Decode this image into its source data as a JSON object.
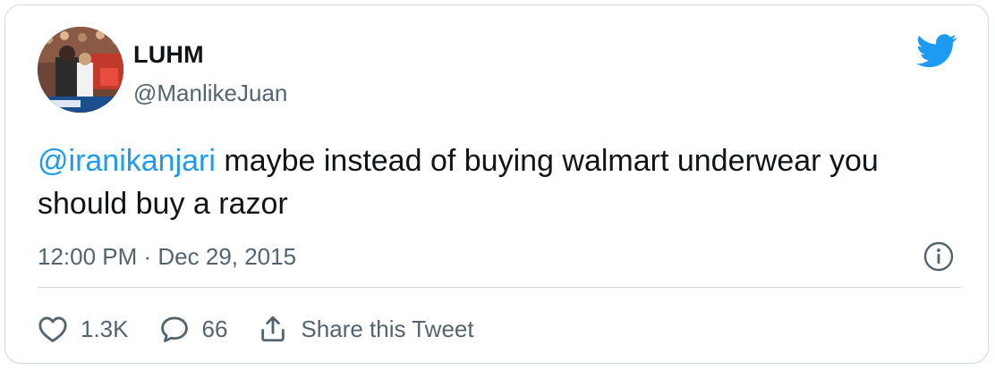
{
  "tweet": {
    "author": {
      "display_name": "LUHM",
      "handle": "@ManlikeJuan",
      "avatar_icon": "avatar-photo"
    },
    "text": {
      "mention": "@iranikanjari",
      "body": " maybe instead of buying walmart underwear you should buy a razor"
    },
    "timestamp": "12:00 PM · Dec 29, 2015",
    "actions": {
      "like_count": "1.3K",
      "reply_count": "66",
      "share_label": "Share this Tweet"
    }
  },
  "icons": {
    "brand": "twitter-bird-icon",
    "info": "info-icon",
    "like": "heart-icon",
    "reply": "reply-bubble-icon",
    "share": "share-icon"
  },
  "colors": {
    "accent": "#1d9bf0",
    "text_primary": "#0f1419",
    "text_secondary": "#536471",
    "border": "#cfd9de"
  }
}
